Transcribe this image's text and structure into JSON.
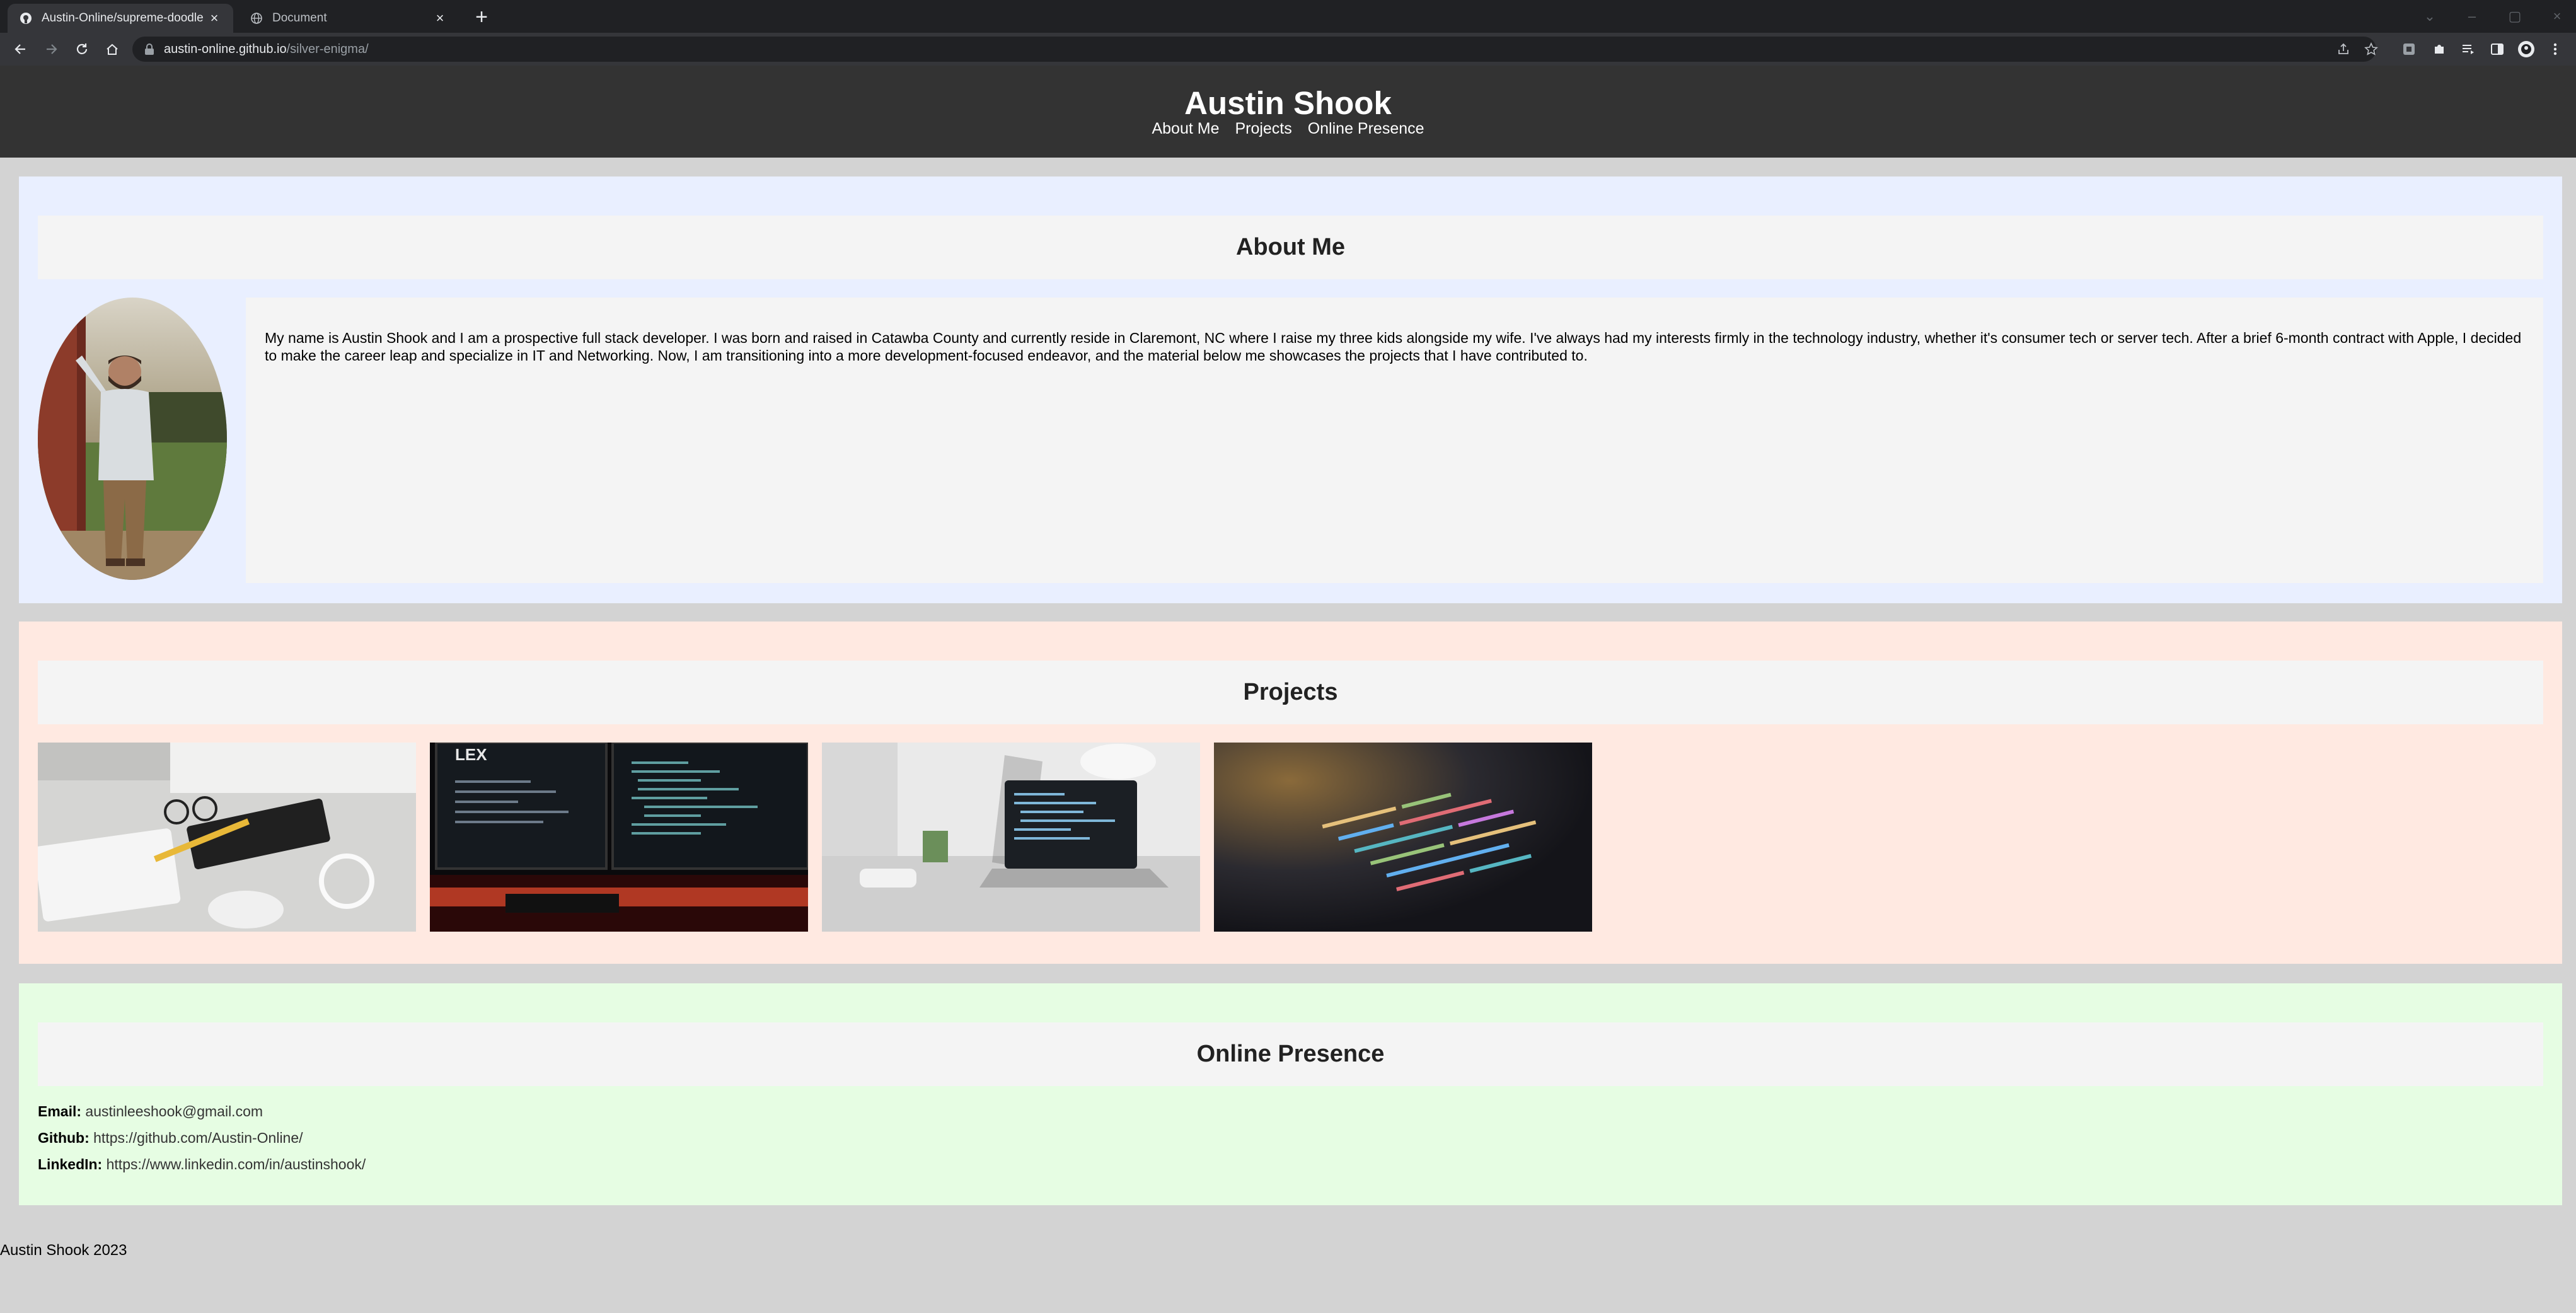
{
  "browser": {
    "tabs": [
      {
        "title": "Austin-Online/supreme-doodle",
        "icon": "github-icon",
        "active": true
      },
      {
        "title": "Document",
        "icon": "globe-icon",
        "active": false
      }
    ],
    "url_domain": "austin-online.github.io",
    "url_path": "/silver-enigma/"
  },
  "header": {
    "title": "Austin Shook",
    "nav": [
      "About Me",
      "Projects",
      "Online Presence"
    ]
  },
  "about": {
    "heading": "About Me",
    "text": "My name is Austin Shook and I am a prospective full stack developer. I was born and raised in Catawba County and currently reside in Claremont, NC where I raise my three kids alongside my wife. I've always had my interests firmly in the technology industry, whether it's consumer tech or server tech. After a brief 6-month contract with Apple, I decided to make the career leap and specialize in IT and Networking. Now, I am transitioning into a more development-focused endeavor, and the material below me showcases the projects that I have contributed to."
  },
  "projects": {
    "heading": "Projects",
    "items": [
      "project-desk-keyboard",
      "project-dual-monitor-setup",
      "project-laptop-workspace",
      "project-code-closeup"
    ]
  },
  "online": {
    "heading": "Online Presence",
    "email_label": "Email:",
    "email": "austinleeshook@gmail.com",
    "github_label": "Github:",
    "github": "https://github.com/Austin-Online/",
    "linkedin_label": "LinkedIn:",
    "linkedin": "https://www.linkedin.com/in/austinshook/"
  },
  "footer": {
    "text": "Austin Shook 2023"
  }
}
